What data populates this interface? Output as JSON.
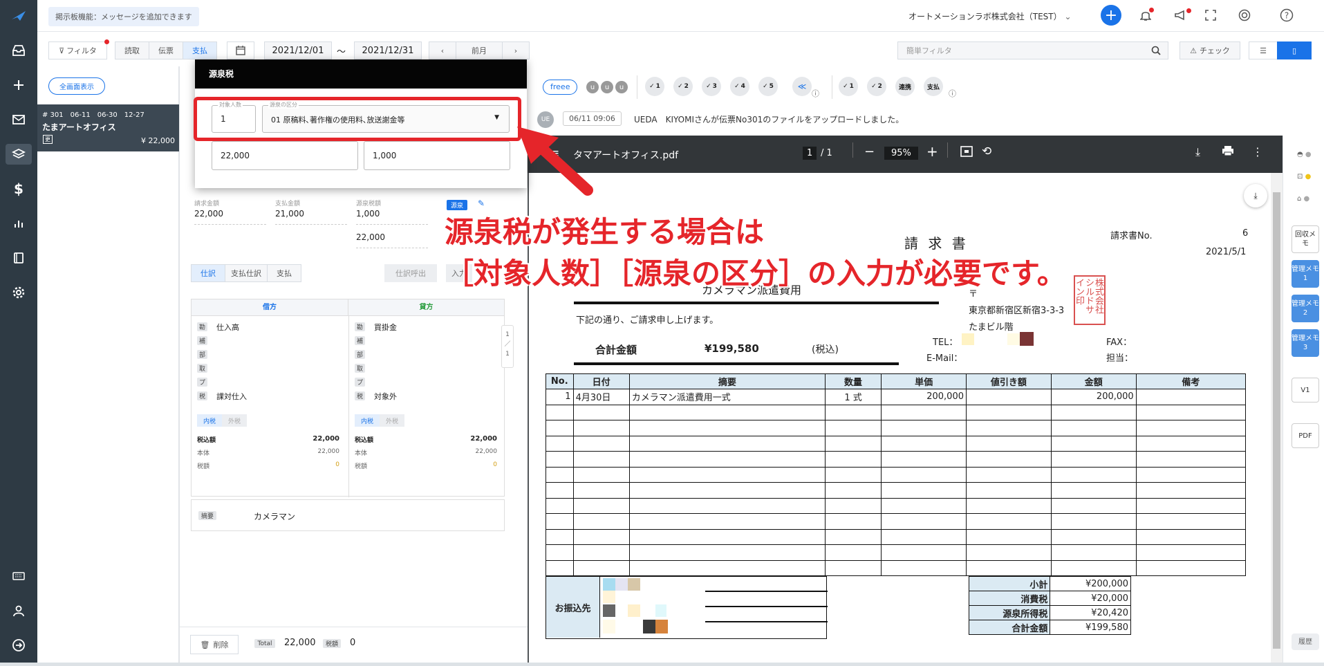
{
  "notice": "掲示板機能：メッセージを追加できます",
  "company": "オートメーションラボ株式会社（TEST）",
  "filter": {
    "filter_label": "フィルタ",
    "seg": [
      "読取",
      "伝票",
      "支払"
    ],
    "date_from": "2021/12/01",
    "sep": "〜",
    "date_to": "2021/12/31",
    "prev_label": "前月",
    "quick_placeholder": "簡単フィルタ",
    "check_label": "チェック"
  },
  "list": {
    "fullscreen_label": "全画面表示",
    "item": {
      "meta": "# 301　06-11　06-30　12-27",
      "name": "たまアートオフィス",
      "badge": "更",
      "amount": "¥ 22,000"
    }
  },
  "popup": {
    "title": "源泉税",
    "count_label": "対象人数",
    "count": "1",
    "kind_label": "源泉の区分",
    "kind": "01 原稿料､著作権の使用料､放送謝金等",
    "amount1": "22,000",
    "amount2": "1,000"
  },
  "amounts": {
    "l1": "請求金額",
    "v1": "22,000",
    "l2": "支払金額",
    "v2": "21,000",
    "l3": "源泉税額",
    "v3": "1,000",
    "v4": "22,000",
    "gensen_tag": "源泉"
  },
  "tabs": [
    "仕訳",
    "支払仕訳",
    "支払"
  ],
  "action": {
    "shiwake_btn": "仕訳呼出",
    "in_btn": "入力"
  },
  "journal": {
    "debit_title": "借方",
    "credit_title": "貸方",
    "debit_rows": [
      {
        "t": "勘",
        "v": "仕入高"
      },
      {
        "t": "補",
        "v": ""
      },
      {
        "t": "部",
        "v": ""
      },
      {
        "t": "取",
        "v": ""
      },
      {
        "t": "プ",
        "v": ""
      },
      {
        "t": "税",
        "v": "課対仕入"
      }
    ],
    "credit_rows": [
      {
        "t": "勘",
        "v": "買掛金"
      },
      {
        "t": "補",
        "v": ""
      },
      {
        "t": "部",
        "v": ""
      },
      {
        "t": "取",
        "v": ""
      },
      {
        "t": "プ",
        "v": ""
      },
      {
        "t": "税",
        "v": "対象外"
      }
    ],
    "tax_in": "内税",
    "tax_out": "外税",
    "sums_left": [
      {
        "l": "税込額",
        "v": "22,000"
      },
      {
        "l": "本体",
        "v": "22,000"
      },
      {
        "l": "税額",
        "v": "0"
      }
    ],
    "sums_right": [
      {
        "l": "税込額",
        "v": "22,000"
      },
      {
        "l": "本体",
        "v": "22,000"
      },
      {
        "l": "税額",
        "v": "0"
      }
    ],
    "page": [
      "1",
      "／",
      "1"
    ],
    "memo_tag": "摘要",
    "memo": "カメラマン"
  },
  "footer": {
    "delete": "削除",
    "total_label": "Total",
    "total": "22,000",
    "tax_label": "税額",
    "tax": "0"
  },
  "status": {
    "freee": "freee",
    "u": "u",
    "checks": [
      "1",
      "2",
      "3",
      "4",
      "5"
    ],
    "checks2": [
      "1",
      "2"
    ],
    "renkei": "連携",
    "shiharai": "支払"
  },
  "log": {
    "avatar": "UE",
    "time": "06/11 09:06",
    "text": "UEDA　KIYOMIさんが伝票No301のファイルをアップロードしました。"
  },
  "pdf": {
    "filename": "タマアートオフィス.pdf",
    "page": "1",
    "page_total": "/  1",
    "zoom": "95%"
  },
  "invoice": {
    "title": "請 求 書",
    "no_label": "請求書No.",
    "no": "6",
    "date": "2021/5/1",
    "subject": "カメラマン派遣費用",
    "greeting": "下記の通り、ご請求申し上げます。",
    "total_label": "合計金額",
    "total": "¥199,580",
    "tax_note": "(税込)",
    "postal": "〒",
    "addr": "東京都新宿区新宿3-3-3",
    "bldg": "たまビル階",
    "tel": "TEL：",
    "fax": "FAX：",
    "email": "E-Mail：",
    "tanto": "担当：",
    "stamp": "株式会社シルドサイン印",
    "headers": [
      "No.",
      "日付",
      "摘要",
      "数量",
      "単価",
      "値引き額",
      "金額",
      "備考"
    ],
    "row1": [
      "1",
      "4月30日",
      "カメラマン派遣費用一式",
      "1 式",
      "200,000",
      "",
      "200,000",
      ""
    ],
    "bank_label": "お振込先",
    "sums": [
      {
        "l": "小計",
        "v": "¥200,000"
      },
      {
        "l": "消費税",
        "v": "¥20,000"
      },
      {
        "l": "源泉所得税",
        "v": "¥20,420"
      },
      {
        "l": "合計金額",
        "v": "¥199,580"
      }
    ]
  },
  "annotation": {
    "line1": "源泉税が発生する場合は",
    "line2": "［対象人数］［源泉の区分］の入力が必要です。"
  },
  "right_rail": {
    "b1": "回収メモ",
    "b2": "管理メモ1",
    "b3": "管理メモ2",
    "b4": "管理メモ3",
    "b5": "V1",
    "b6": "PDF",
    "b7": "履歴"
  },
  "colors": {
    "rail": "#2e3a44",
    "accent": "#1a73e8",
    "red": "#e5252a"
  }
}
